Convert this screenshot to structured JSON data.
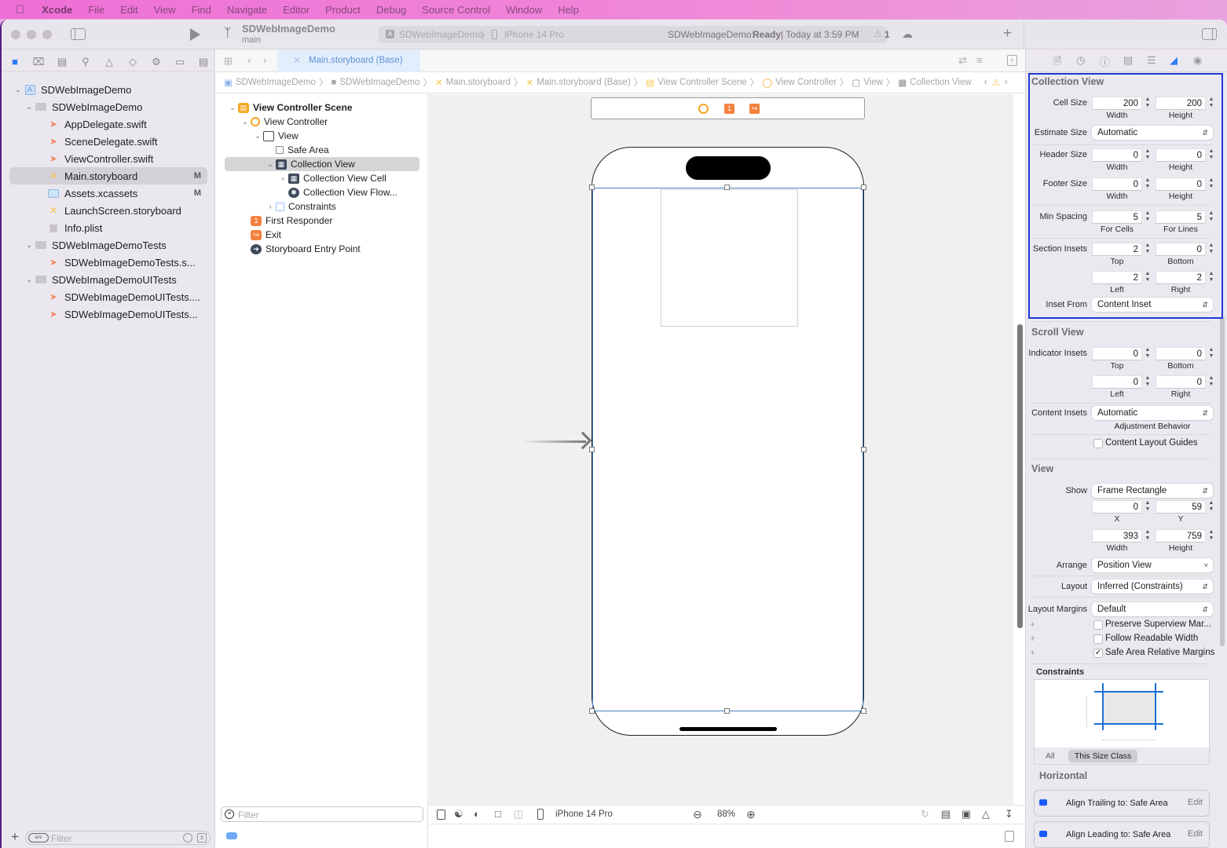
{
  "menubar": {
    "apple": "",
    "items": [
      "Xcode",
      "File",
      "Edit",
      "View",
      "Find",
      "Navigate",
      "Editor",
      "Product",
      "Debug",
      "Source Control",
      "Window",
      "Help"
    ]
  },
  "toolbar": {
    "project_name": "SDWebImageDemo",
    "branch": "main",
    "scheme": "SDWebImageDemo",
    "destination": "iPhone 14 Pro",
    "status_project": "SDWebImageDemo:",
    "status_state": "Ready",
    "status_time": "| Today at 3:59 PM",
    "warning_count": "1",
    "add_label": "+"
  },
  "navigator": {
    "tree": [
      {
        "label": "SDWebImageDemo",
        "level": 0,
        "type": "project",
        "expanded": true
      },
      {
        "label": "SDWebImageDemo",
        "level": 1,
        "type": "folder",
        "expanded": true
      },
      {
        "label": "AppDelegate.swift",
        "level": 2,
        "type": "swift"
      },
      {
        "label": "SceneDelegate.swift",
        "level": 2,
        "type": "swift"
      },
      {
        "label": "ViewController.swift",
        "level": 2,
        "type": "swift"
      },
      {
        "label": "Main.storyboard",
        "level": 2,
        "type": "storyboard",
        "badge": "M",
        "selected": true
      },
      {
        "label": "Assets.xcassets",
        "level": 2,
        "type": "assets",
        "badge": "M"
      },
      {
        "label": "LaunchScreen.storyboard",
        "level": 2,
        "type": "storyboard"
      },
      {
        "label": "Info.plist",
        "level": 2,
        "type": "plist"
      },
      {
        "label": "SDWebImageDemoTests",
        "level": 1,
        "type": "folder",
        "expanded": true
      },
      {
        "label": "SDWebImageDemoTests.s...",
        "level": 2,
        "type": "swift"
      },
      {
        "label": "SDWebImageDemoUITests",
        "level": 1,
        "type": "folder",
        "expanded": true
      },
      {
        "label": "SDWebImageDemoUITests....",
        "level": 2,
        "type": "swift"
      },
      {
        "label": "SDWebImageDemoUITests...",
        "level": 2,
        "type": "swift"
      }
    ],
    "filter_placeholder": "Filter"
  },
  "editor": {
    "tab_label": "Main.storyboard (Base)",
    "breadcrumb": [
      "SDWebImageDemo",
      "SDWebImageDemo",
      "Main.storyboard",
      "Main.storyboard (Base)",
      "View Controller Scene",
      "View Controller",
      "View",
      "Collection View"
    ]
  },
  "outline": {
    "rows": [
      {
        "label": "View Controller Scene",
        "bold": true
      },
      {
        "label": "View Controller"
      },
      {
        "label": "View"
      },
      {
        "label": "Safe Area"
      },
      {
        "label": "Collection View",
        "selected": true
      },
      {
        "label": "Collection View Cell"
      },
      {
        "label": "Collection View Flow..."
      },
      {
        "label": "Constraints"
      },
      {
        "label": "First Responder"
      },
      {
        "label": "Exit"
      },
      {
        "label": "Storyboard Entry Point"
      }
    ],
    "filter_placeholder": "Filter"
  },
  "canvas_bar": {
    "device": "iPhone 14 Pro",
    "zoom": "88%"
  },
  "inspector": {
    "collection_view": {
      "title": "Collection View",
      "cell_size": {
        "label": "Cell Size",
        "width": "200",
        "height": "200",
        "sub1": "Width",
        "sub2": "Height"
      },
      "estimate_size": {
        "label": "Estimate Size",
        "value": "Automatic"
      },
      "header_size": {
        "label": "Header Size",
        "width": "0",
        "height": "0",
        "sub1": "Width",
        "sub2": "Height"
      },
      "footer_size": {
        "label": "Footer Size",
        "width": "0",
        "height": "0",
        "sub1": "Width",
        "sub2": "Height"
      },
      "min_spacing": {
        "label": "Min Spacing",
        "cells": "5",
        "lines": "5",
        "sub1": "For Cells",
        "sub2": "For Lines"
      },
      "section_insets": {
        "label": "Section Insets",
        "top": "2",
        "bottom": "0",
        "left": "2",
        "right": "2",
        "sub_top": "Top",
        "sub_bottom": "Bottom",
        "sub_left": "Left",
        "sub_right": "Right"
      },
      "inset_from": {
        "label": "Inset From",
        "value": "Content Inset"
      }
    },
    "scroll_view": {
      "title": "Scroll View",
      "indicator_insets": {
        "label": "Indicator Insets",
        "top": "0",
        "bottom": "0",
        "left": "0",
        "right": "0",
        "sub_top": "Top",
        "sub_bottom": "Bottom",
        "sub_left": "Left",
        "sub_right": "Right"
      },
      "content_insets": {
        "label": "Content Insets",
        "value": "Automatic",
        "caption": "Adjustment Behavior"
      },
      "content_layout_guides": {
        "label": "Content Layout Guides",
        "checked": false
      }
    },
    "view": {
      "title": "View",
      "show": {
        "label": "Show",
        "value": "Frame Rectangle"
      },
      "x": "0",
      "y": "59",
      "width": "393",
      "height": "759",
      "sub_x": "X",
      "sub_y": "Y",
      "sub_w": "Width",
      "sub_h": "Height",
      "arrange": {
        "label": "Arrange",
        "value": "Position View"
      },
      "layout": {
        "label": "Layout",
        "value": "Inferred (Constraints)"
      },
      "layout_margins": {
        "label": "Layout Margins",
        "value": "Default"
      },
      "checks": [
        {
          "label": "Preserve Superview Mar...",
          "checked": false
        },
        {
          "label": "Follow Readable Width",
          "checked": false
        },
        {
          "label": "Safe Area Relative Margins",
          "checked": true
        }
      ]
    },
    "constraints": {
      "title": "Constraints",
      "seg_all": "All",
      "seg_size_class": "This Size Class",
      "horizontal_title": "Horizontal",
      "items": [
        {
          "label": "Align Trailing to:  Safe Area",
          "edit": "Edit"
        },
        {
          "label": "Align Leading to:  Safe Area",
          "edit": "Edit"
        }
      ]
    }
  },
  "colors": {
    "accent": "#1a5cff",
    "selection_box": "#1d39d6",
    "menubar": "#ee6fd6",
    "swift": "#f08b6b",
    "storyboard": "#f5c542"
  }
}
